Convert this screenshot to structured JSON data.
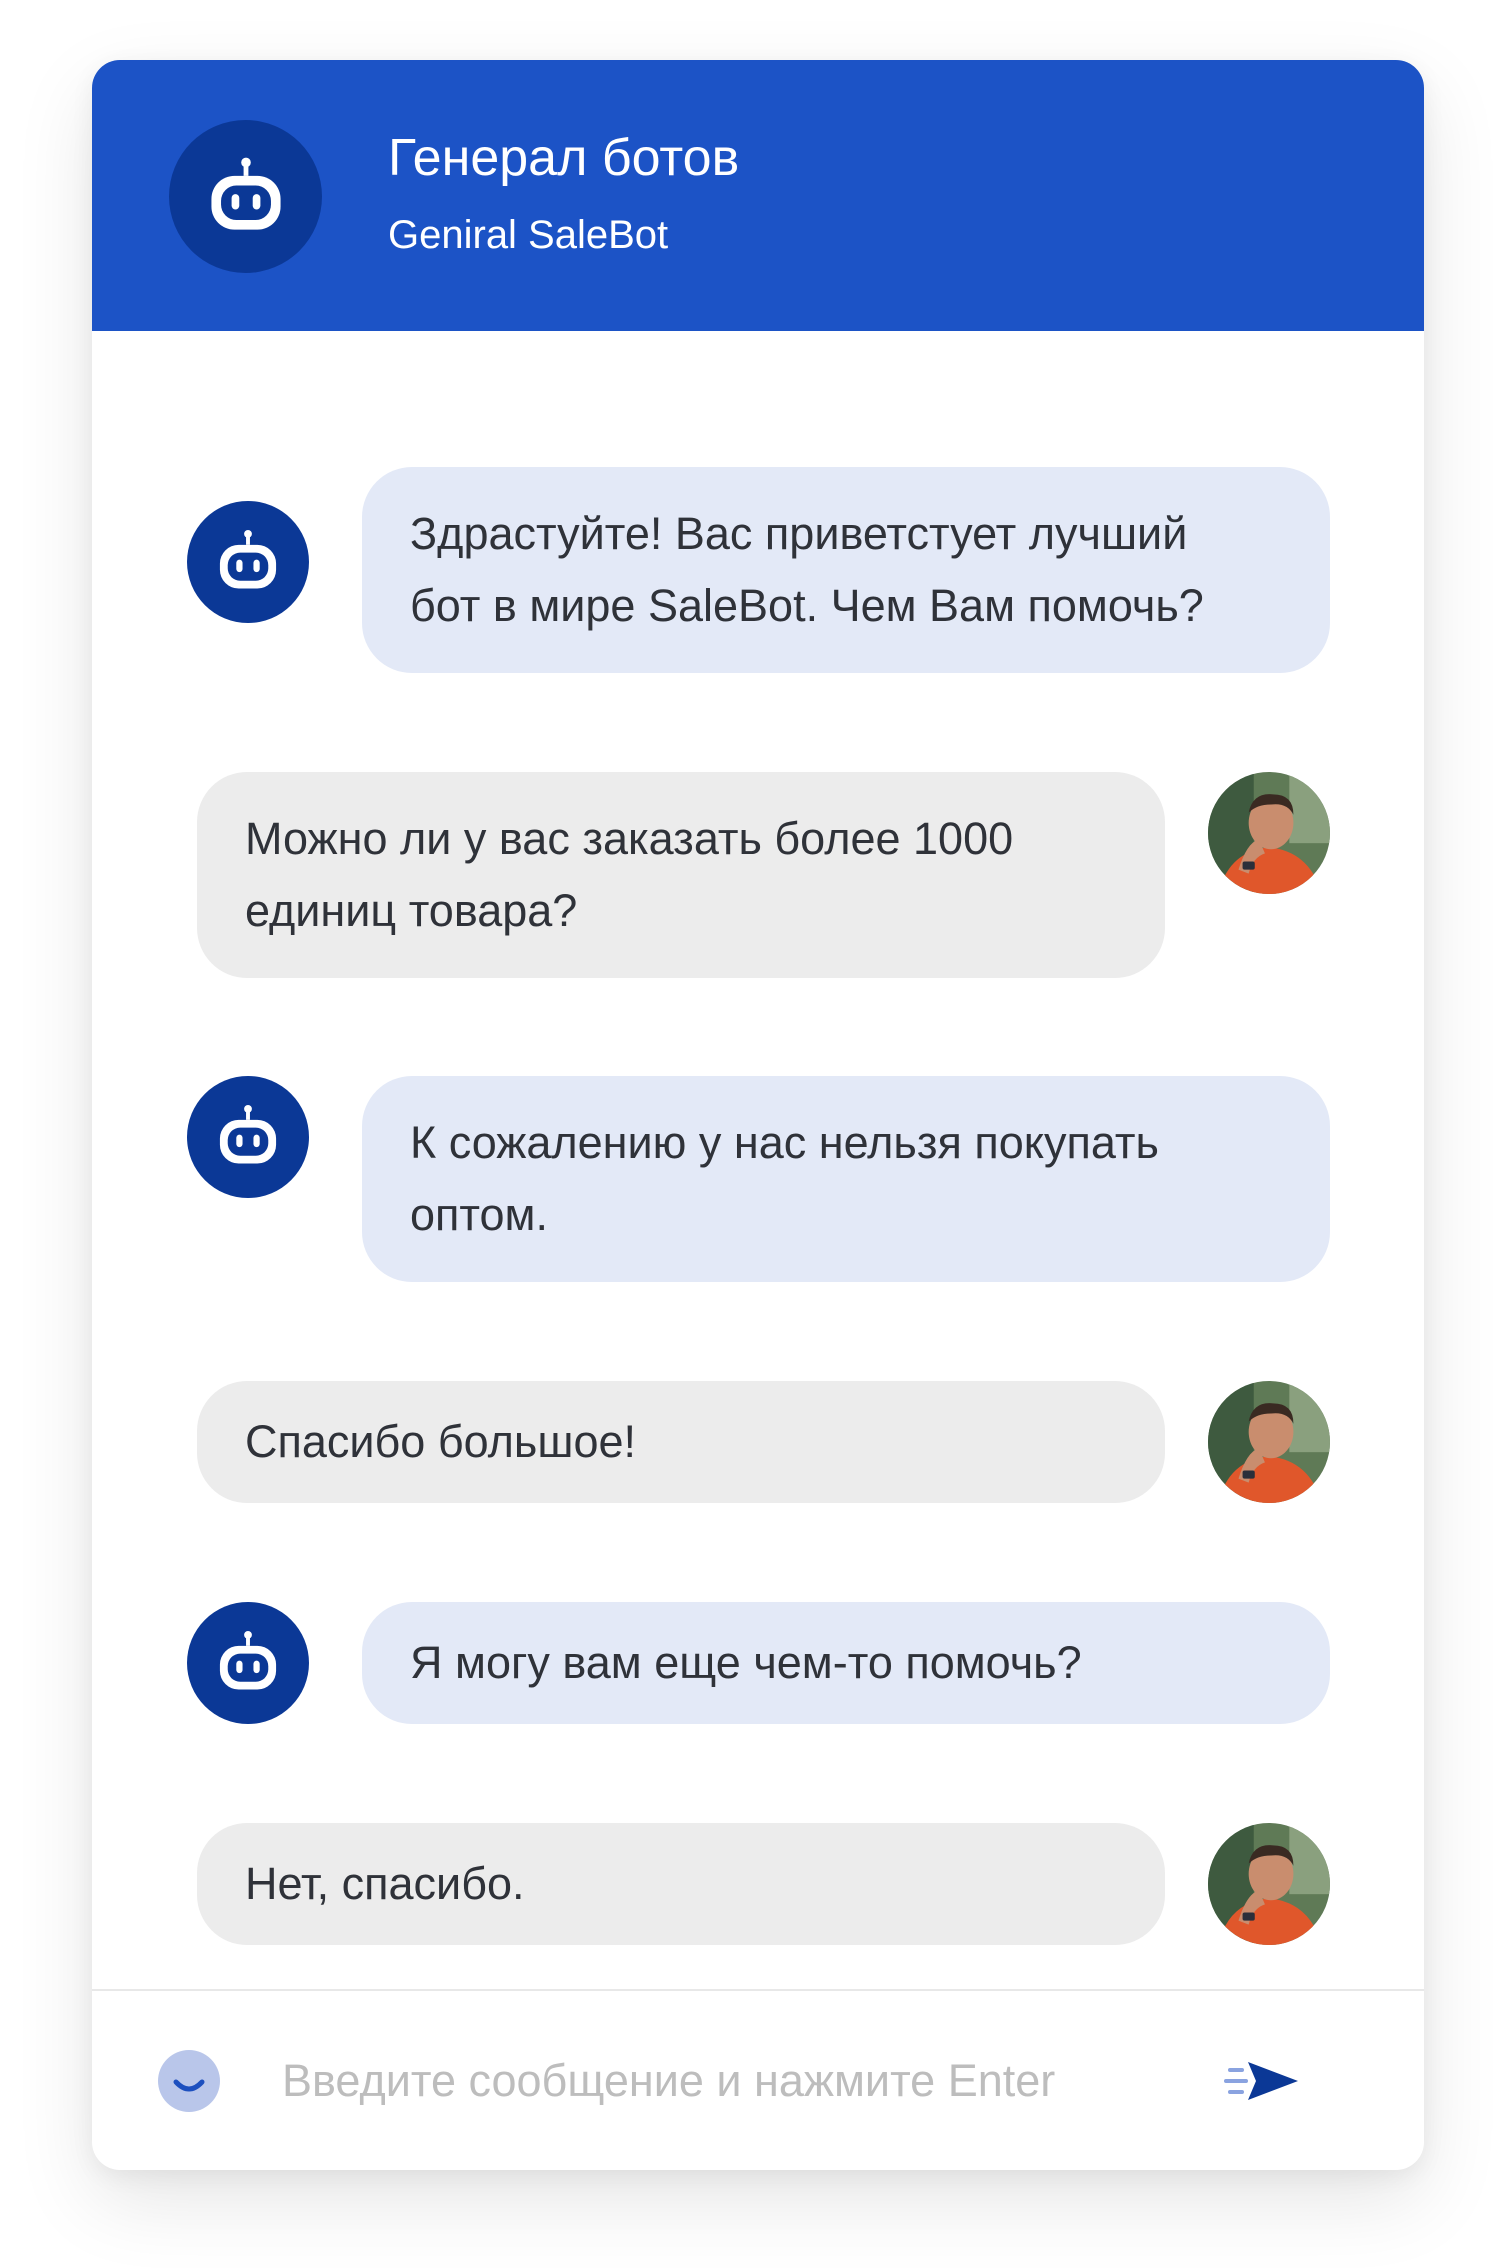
{
  "header": {
    "title": "Генерал ботов",
    "subtitle": "Geniral SaleBot",
    "avatar_icon": "robot-icon"
  },
  "messages": [
    {
      "sender": "bot",
      "lines": [
        "Здрастуйте! Вас приветстует лучший",
        "бот в мире SaleBot. Чем Вам помочь?"
      ]
    },
    {
      "sender": "user",
      "lines": [
        "Можно ли у вас заказать более 1000",
        "единиц товара?"
      ]
    },
    {
      "sender": "bot",
      "lines": [
        "К сожалению у нас нельзя покупать",
        "оптом."
      ]
    },
    {
      "sender": "user",
      "lines": [
        "Спасибо большое!"
      ]
    },
    {
      "sender": "bot",
      "lines": [
        "Я могу вам еще чем-то помочь?"
      ]
    },
    {
      "sender": "user",
      "lines": [
        "Нет, спасибо."
      ]
    }
  ],
  "composer": {
    "placeholder": "Введите сообщение и нажмите Enter",
    "value": "",
    "emoji_icon": "smile-icon",
    "send_icon": "send-icon"
  },
  "colors": {
    "header_bg": "#1c53c6",
    "avatar_bg": "#0b3896",
    "bot_bubble": "#e3e9f7",
    "user_bubble": "#ececec",
    "text": "#2f3239",
    "placeholder": "#bdbdbd"
  }
}
